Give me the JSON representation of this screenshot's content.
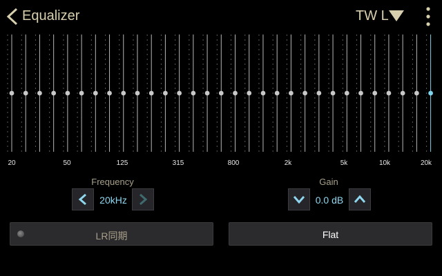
{
  "header": {
    "title": "Equalizer",
    "preset_label": "TW L"
  },
  "equalizer": {
    "band_count": 31,
    "gain_levels_db": [
      0,
      0,
      0,
      0,
      0,
      0,
      0,
      0,
      0,
      0,
      0,
      0,
      0,
      0,
      0,
      0,
      0,
      0,
      0,
      0,
      0,
      0,
      0,
      0,
      0,
      0,
      0,
      0,
      0,
      0,
      0
    ],
    "selected_band": 30,
    "accent_color": "#7fd3ec",
    "frequency_labels": [
      "20",
      "50",
      "125",
      "315",
      "800",
      "2k",
      "5k",
      "10k",
      "20k"
    ]
  },
  "frequency_control": {
    "label": "Frequency",
    "value": "20kHz"
  },
  "gain_control": {
    "label": "Gain",
    "value": "0.0 dB"
  },
  "buttons": {
    "lr_sync_label": "LR同期",
    "flat_label": "Flat"
  },
  "colors": {
    "text_gold": "#d8cfae",
    "value_blue": "#8fd7ef",
    "button_bg": "#2b2a2c"
  }
}
